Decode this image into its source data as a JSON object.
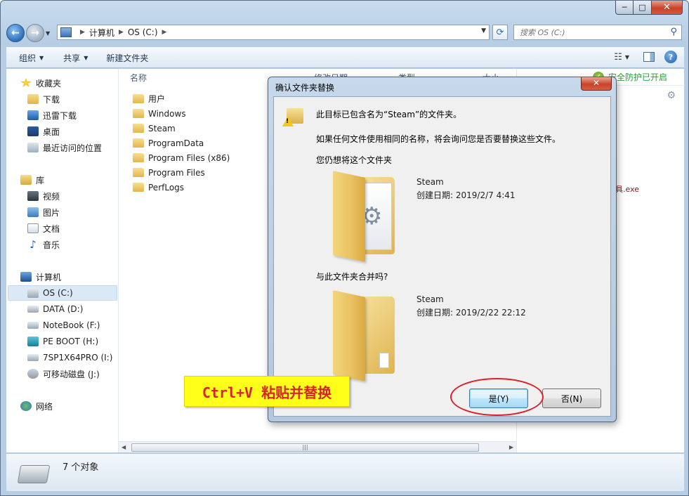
{
  "titlebar": {
    "minimize": "─",
    "maximize": "□",
    "close": "✕"
  },
  "nav": {
    "back": "←",
    "forward": "→",
    "breadcrumbs": [
      "计算机",
      "OS (C:)"
    ],
    "search_placeholder": "搜索 OS (C:)"
  },
  "toolbar": {
    "organize": "组织",
    "share": "共享",
    "new_folder": "新建文件夹",
    "help": "?"
  },
  "sidebar": {
    "favorites": "收藏夹",
    "downloads": "下载",
    "xunlei": "迅雷下载",
    "desktop": "桌面",
    "recent": "最近访问的位置",
    "libraries": "库",
    "videos": "视频",
    "pictures": "图片",
    "documents": "文档",
    "music": "音乐",
    "computer": "计算机",
    "drives": [
      "OS (C:)",
      "DATA (D:)",
      "NoteBook (F:)",
      "PE BOOT (H:)",
      "7SP1X64PRO (I:)",
      "可移动磁盘 (J:)"
    ],
    "network": "网络"
  },
  "filelist": {
    "col_name": "名称",
    "col_date_fragment": "修改日期",
    "col_type_fragment": "类型",
    "col_size_fragment": "大小",
    "files": [
      "用户",
      "Windows",
      "Steam",
      "ProgramData",
      "Program Files (x86)",
      "Program Files",
      "PerfLogs"
    ]
  },
  "rightpane": {
    "security": "安全防护已开启",
    "exe_fragment": "具.exe"
  },
  "statusbar": {
    "count": "7 个对象"
  },
  "dialog": {
    "title": "确认文件夹替换",
    "close": "✕",
    "msg1": "此目标已包含名为“Steam”的文件夹。",
    "msg2": "如果任何文件使用相同的名称，将会询问您是否要替换这些文件。",
    "msg3": "您仍想将这个文件夹",
    "msg4": "与此文件夹合并吗?",
    "src_name": "Steam",
    "src_date": "创建日期: 2019/2/7 4:41",
    "dst_name": "Steam",
    "dst_date": "创建日期: 2019/2/22 22:12",
    "yes": "是(Y)",
    "no": "否(N)"
  },
  "annotation": {
    "callout": "Ctrl+V 粘贴并替换",
    "highlight_color": "#d8232a",
    "callout_bg": "#ffff1a"
  }
}
